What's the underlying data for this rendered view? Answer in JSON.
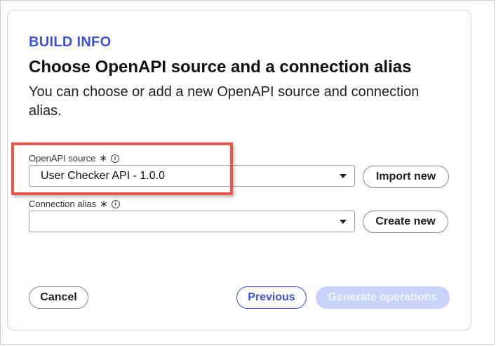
{
  "header": {
    "eyebrow": "BUILD INFO",
    "title": "Choose OpenAPI source and a connection alias",
    "description": "You can choose or add a new OpenAPI source and connection alias."
  },
  "fields": {
    "openapi_source": {
      "label": "OpenAPI source",
      "required_mark": "∗",
      "info_icon": "i",
      "value": "User Checker API - 1.0.0",
      "action_label": "Import new"
    },
    "connection_alias": {
      "label": "Connection alias",
      "required_mark": "∗",
      "info_icon": "i",
      "value": "",
      "action_label": "Create new"
    }
  },
  "footer": {
    "cancel_label": "Cancel",
    "previous_label": "Previous",
    "generate_label": "Generate operations"
  },
  "colors": {
    "accent": "#3f51d8",
    "highlight": "#e8564c",
    "disabled_button": "#c9d3fb"
  },
  "icons": [
    "asterisk-required-icon",
    "info-icon",
    "dropdown-caret-icon"
  ]
}
